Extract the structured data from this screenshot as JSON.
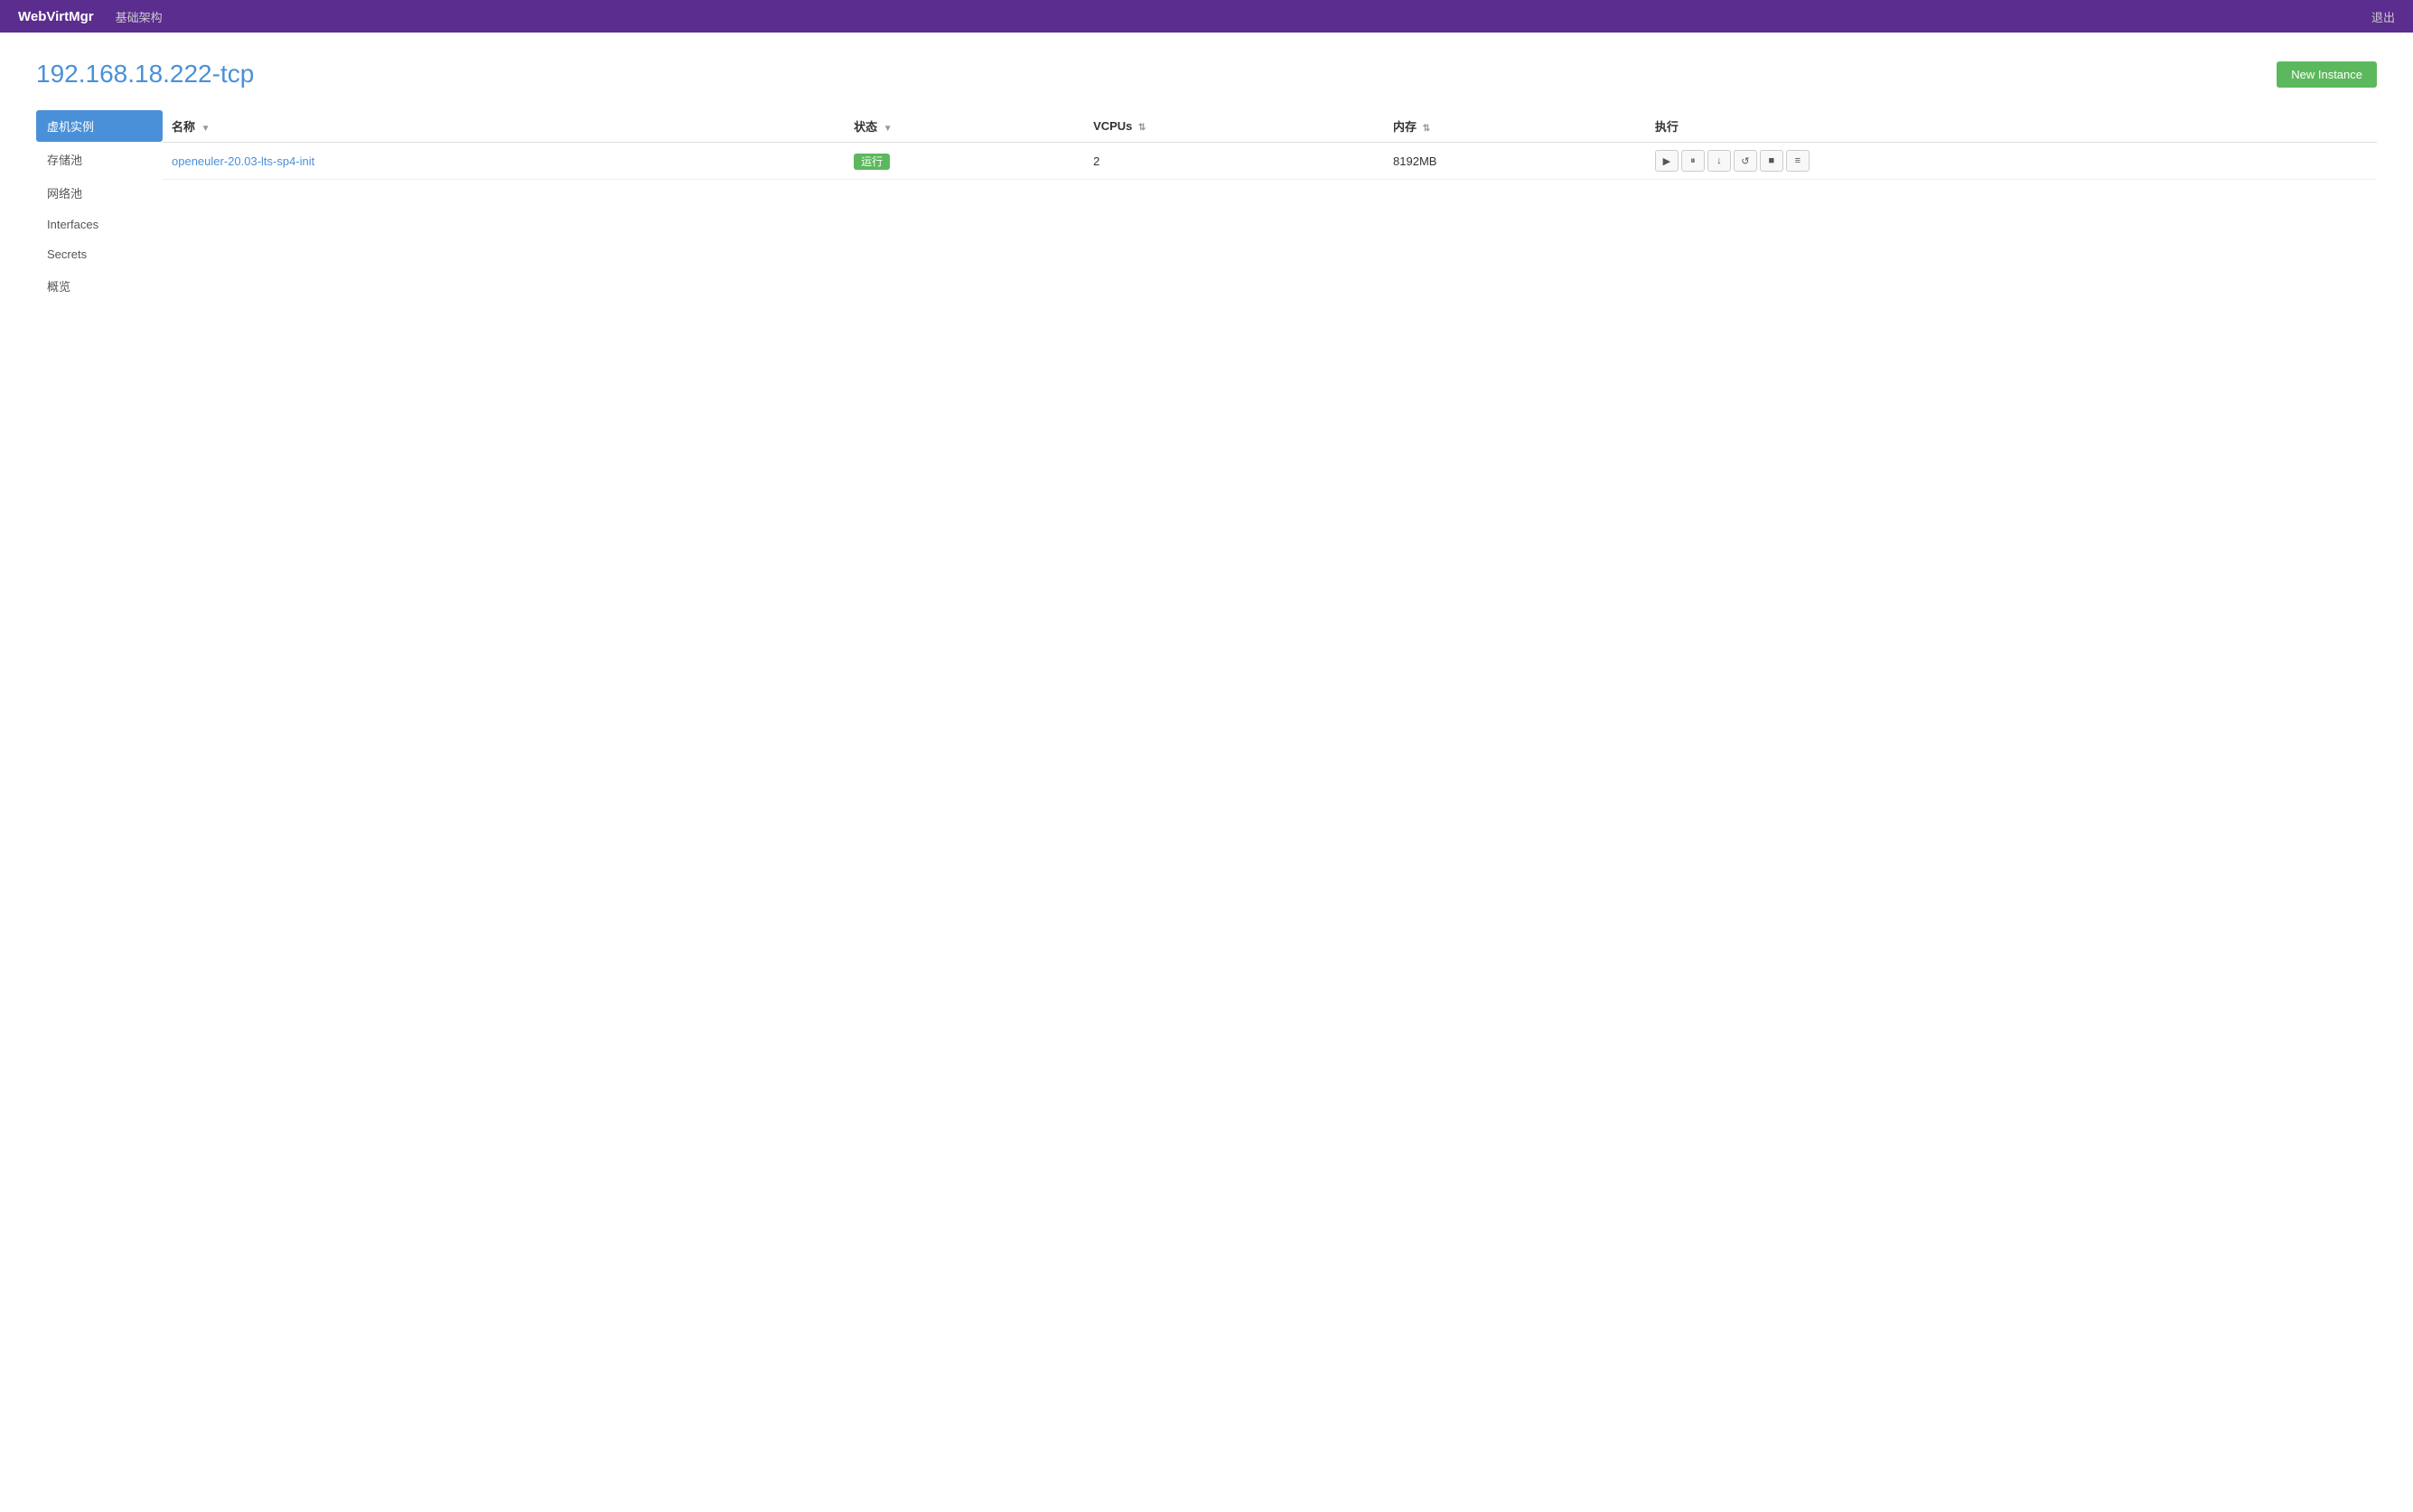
{
  "topnav": {
    "brand": "WebVirtMgr",
    "link": "基础架构",
    "logout": "退出"
  },
  "page": {
    "title": "192.168.18.222-tcp",
    "new_instance_label": "New Instance"
  },
  "sidebar": {
    "items": [
      {
        "id": "vm-instances",
        "label": "虚机实例",
        "active": true
      },
      {
        "id": "storage-pool",
        "label": "存储池",
        "active": false
      },
      {
        "id": "network-pool",
        "label": "网络池",
        "active": false
      },
      {
        "id": "interfaces",
        "label": "Interfaces",
        "active": false
      },
      {
        "id": "secrets",
        "label": "Secrets",
        "active": false
      },
      {
        "id": "overview",
        "label": "概览",
        "active": false
      }
    ]
  },
  "table": {
    "columns": [
      {
        "key": "name",
        "label": "名称",
        "sortable": true
      },
      {
        "key": "status",
        "label": "状态",
        "sortable": true
      },
      {
        "key": "vcpus",
        "label": "VCPUs",
        "sortable": true
      },
      {
        "key": "memory",
        "label": "内存",
        "sortable": true
      },
      {
        "key": "actions",
        "label": "执行",
        "sortable": false
      }
    ],
    "rows": [
      {
        "name": "openeuler-20.03-lts-sp4-init",
        "status": "运行",
        "vcpus": "2",
        "memory": "8192MB",
        "status_color": "#5cb85c"
      }
    ]
  },
  "action_buttons": [
    {
      "name": "start",
      "icon": "▶",
      "title": "Start"
    },
    {
      "name": "pause",
      "icon": "⏸",
      "title": "Pause"
    },
    {
      "name": "shutdown",
      "icon": "↓",
      "title": "Shutdown"
    },
    {
      "name": "reboot",
      "icon": "↺",
      "title": "Reboot"
    },
    {
      "name": "stop",
      "icon": "■",
      "title": "Stop"
    },
    {
      "name": "console",
      "icon": "≡",
      "title": "Console"
    }
  ]
}
